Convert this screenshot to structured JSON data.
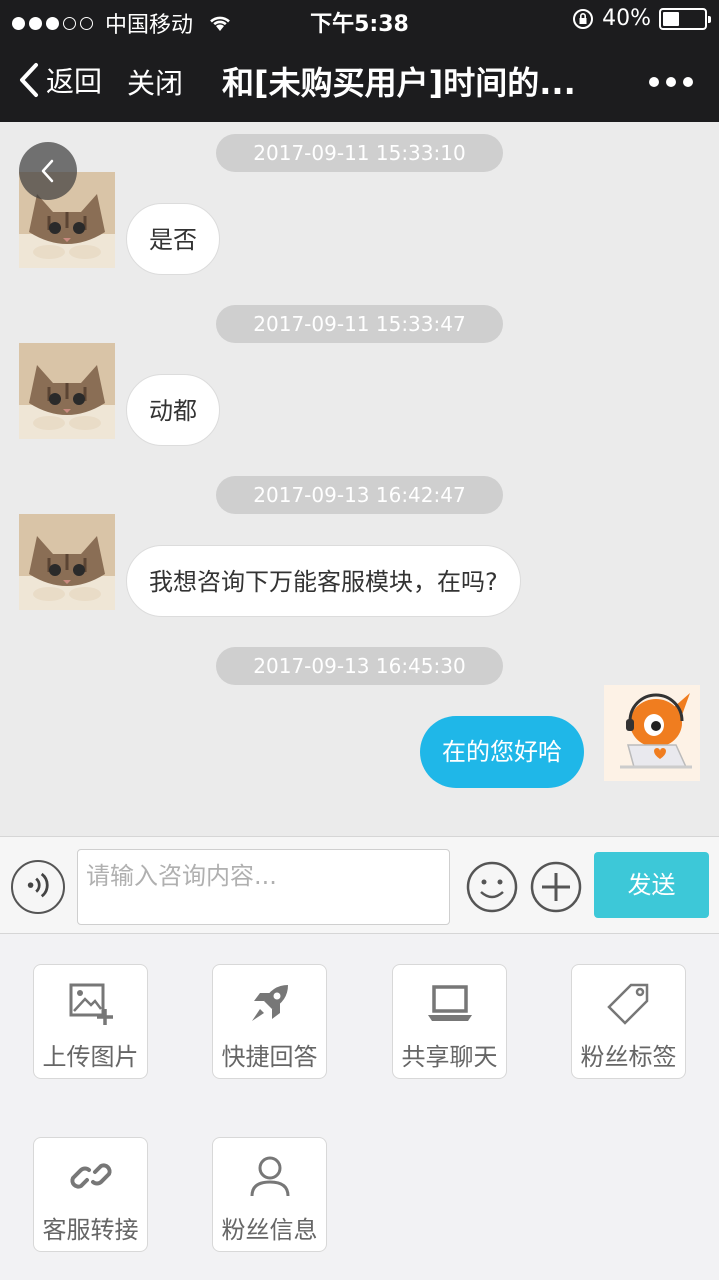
{
  "status_bar": {
    "carrier": "中国移动",
    "time": "下午5:38",
    "battery_percent": "40%",
    "battery_level": 0.4
  },
  "nav": {
    "back_label": "返回",
    "close_label": "关闭",
    "title": "和[未购买用户]时间的..."
  },
  "messages": [
    {
      "timestamp": "2017-09-11 15:33:10",
      "side": "left",
      "text": "是否"
    },
    {
      "timestamp": "2017-09-11 15:33:47",
      "side": "left",
      "text": "动都"
    },
    {
      "timestamp": "2017-09-13 16:42:47",
      "side": "left",
      "text": "我想咨询下万能客服模块，在吗?"
    },
    {
      "timestamp": "2017-09-13 16:45:30",
      "side": "right",
      "text": "在的您好哈"
    }
  ],
  "input": {
    "placeholder": "请输入咨询内容...",
    "value": "",
    "send_label": "发送"
  },
  "tools": [
    {
      "label": "上传图片",
      "icon": "upload-image-icon"
    },
    {
      "label": "快捷回答",
      "icon": "rocket-icon"
    },
    {
      "label": "共享聊天",
      "icon": "laptop-icon"
    },
    {
      "label": "粉丝标签",
      "icon": "tag-icon"
    },
    {
      "label": "客服转接",
      "icon": "link-icon"
    },
    {
      "label": "粉丝信息",
      "icon": "user-icon"
    }
  ],
  "colors": {
    "nav_bg": "#1c1c1e",
    "chat_bg": "#ebebeb",
    "outgoing_bubble": "#1fb7e8",
    "send_button": "#3dc8d8"
  }
}
